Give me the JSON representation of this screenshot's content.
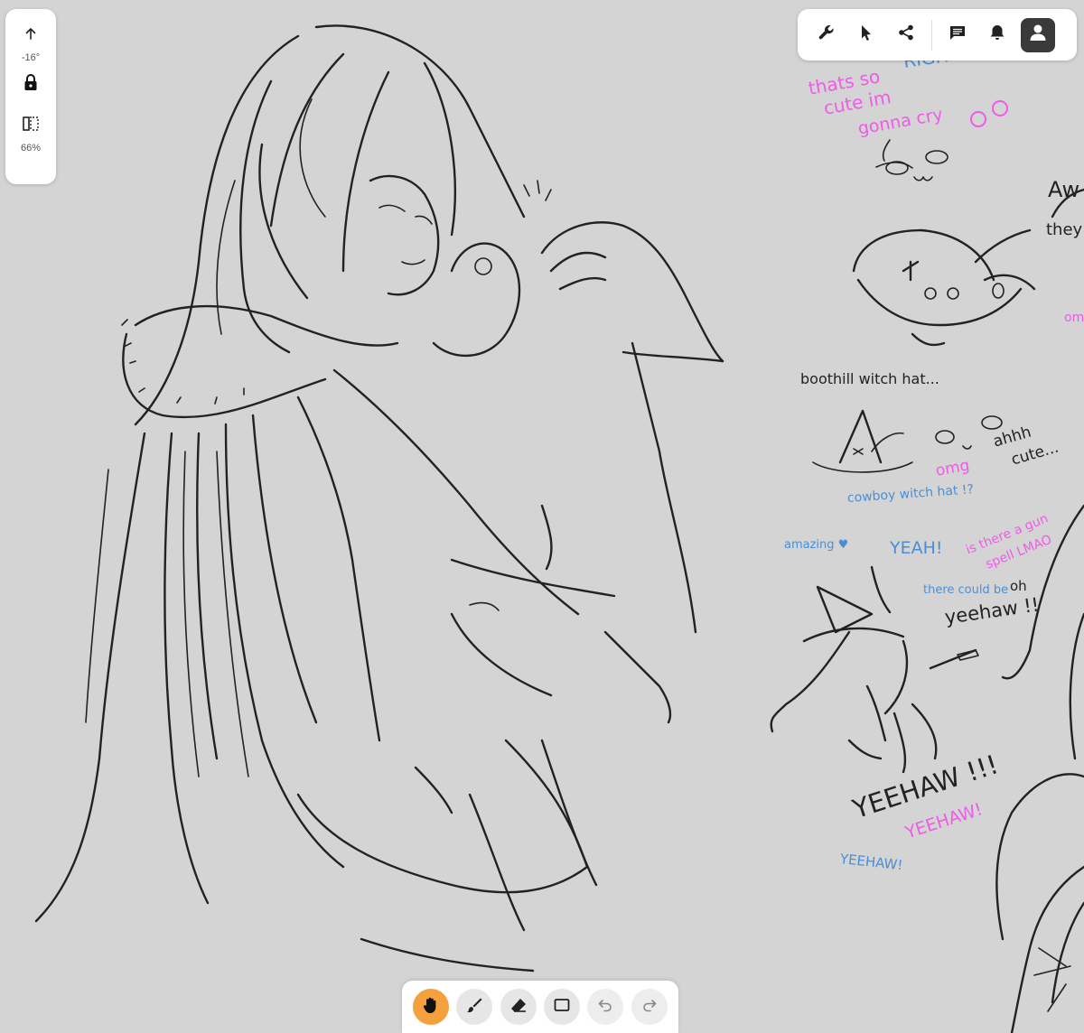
{
  "left_panel": {
    "rotation_label": "-16°",
    "zoom_label": "66%"
  },
  "top_toolbar": {
    "buttons": [
      "wrench-icon",
      "pointer-icon",
      "share-icon",
      "chat-icon",
      "bell-icon",
      "user-icon"
    ]
  },
  "bottom_toolbar": {
    "active_tool": "hand",
    "buttons": [
      "hand-icon",
      "brush-icon",
      "eraser-icon",
      "rectangle-icon",
      "undo-icon",
      "redo-icon"
    ]
  },
  "notes": {
    "right": "RIGHT",
    "thats_so": "thats so",
    "cute_im": "cute im",
    "gonna_cry": "gonna cry",
    "aw": "Aw",
    "they": "they",
    "boothill_witch_hat": "boothill witch hat...",
    "omg": "omg",
    "ahhh_cute": "ahhh",
    "cute_word": "cute...",
    "cowboy_witch_hat": "cowboy witch hat !?",
    "amazing": "amazing ♥",
    "yeah": "YEAH!",
    "is_there_a_gun": "is there a gun",
    "spell_lmao": "spell LMAO",
    "there_could_be": "there could be",
    "oh": "oh",
    "yeehaw_small": "yeehaw !!",
    "yeehaw_big": "YEEHAW !!!",
    "yeehaw_pink": "YEEHAW!",
    "yeehaw_blue": "YEEHAW!",
    "omg_side": "omg"
  },
  "colors": {
    "canvas": "#d4d4d4",
    "active_tool": "#f4a03c",
    "pink_ink": "#f05ae8",
    "blue_ink": "#4a8fd6"
  }
}
